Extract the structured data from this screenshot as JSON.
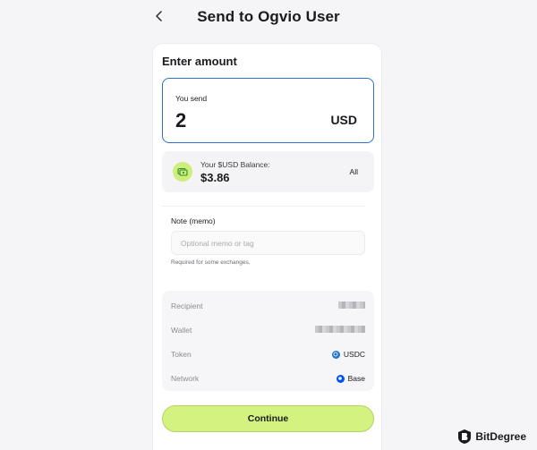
{
  "header": {
    "back_icon": "chevron-left-icon",
    "title": "Send to Ogvio User"
  },
  "amount": {
    "section_title": "Enter amount",
    "label": "You send",
    "value": "2",
    "currency": "USD"
  },
  "balance": {
    "icon": "wallet-icon",
    "label": "Your $USD Balance:",
    "value": "$3.86",
    "all_label": "All"
  },
  "memo": {
    "label": "Note (memo)",
    "placeholder": "Optional memo or tag",
    "value": "",
    "hint": "Required for some exchanges."
  },
  "details": {
    "rows": [
      {
        "label": "Recipient"
      },
      {
        "label": "Wallet"
      },
      {
        "label": "Token",
        "value": "USDC",
        "icon": "usdc-icon"
      },
      {
        "label": "Network",
        "value": "Base",
        "icon": "base-network-icon"
      }
    ]
  },
  "actions": {
    "continue_label": "Continue"
  },
  "watermark": {
    "text": "BitDegree",
    "icon": "bitdegree-logo-icon"
  },
  "colors": {
    "accent_border": "#2f6fd6",
    "button_lime": "#d3f27f",
    "wallet_icon_bg": "#cdee7a",
    "usdc_blue": "#2775ca",
    "base_blue": "#0052ff"
  }
}
